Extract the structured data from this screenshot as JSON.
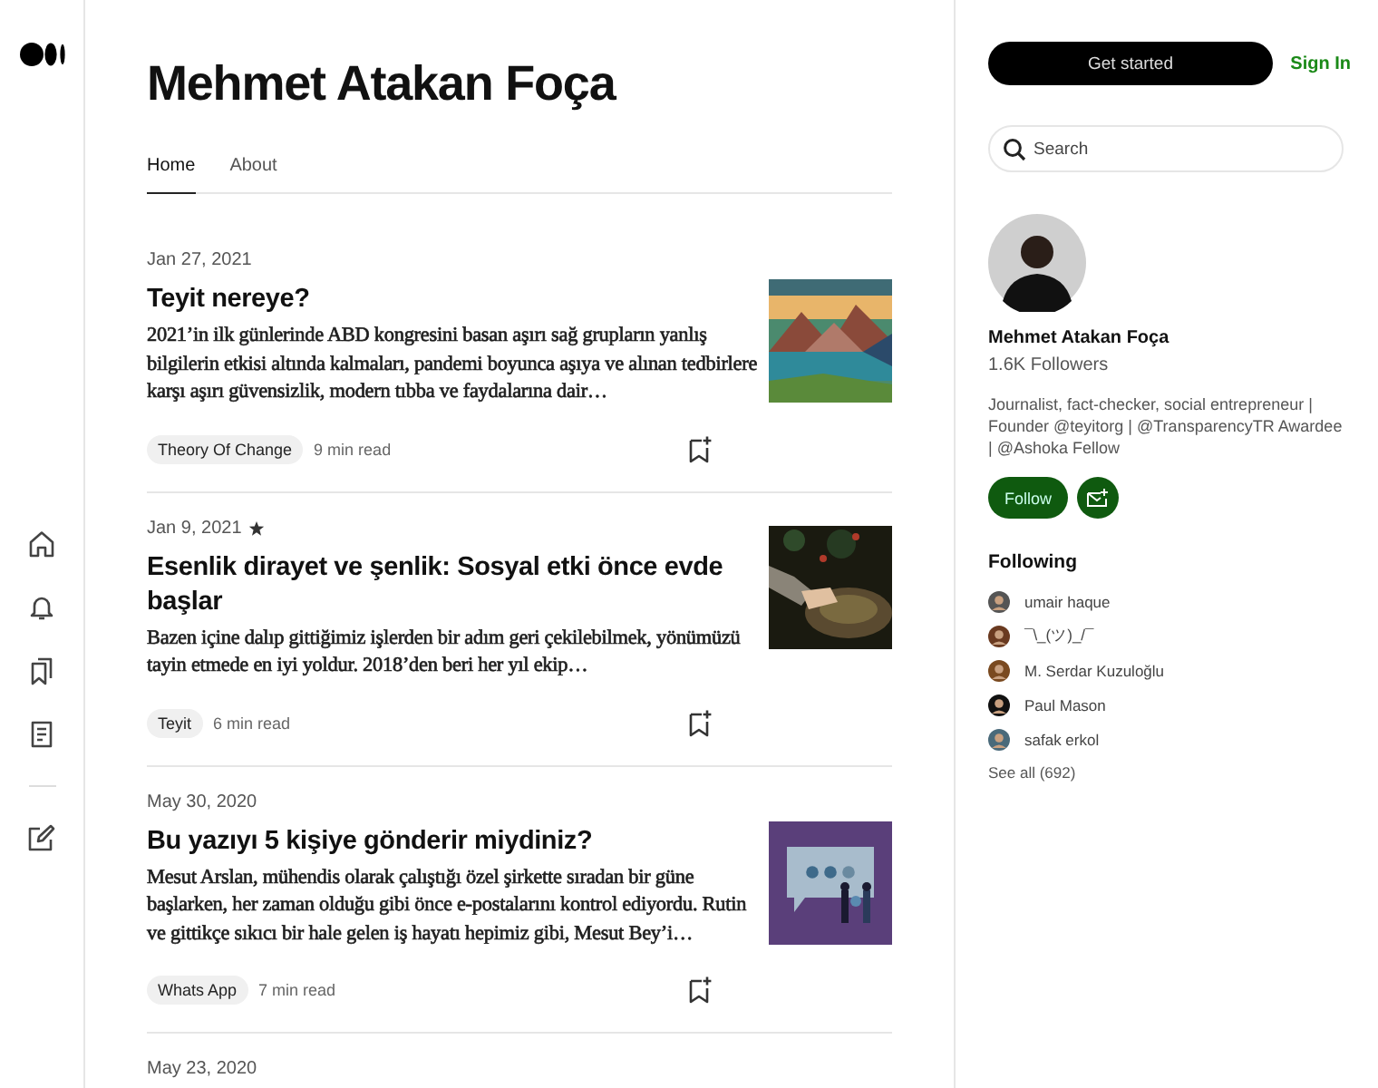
{
  "page_title": "Mehmet Atakan Foça",
  "profile": {
    "name": "Mehmet Atakan Foça",
    "followers": "1.6K Followers",
    "bio": "Journalist, fact-checker, social entrepreneur | Founder @teyitorg | @TransparencyTR Awardee | @Ashoka Fellow",
    "follow_button": "Follow"
  },
  "tabs": [
    {
      "label": "Home",
      "selected": true
    },
    {
      "label": "About",
      "selected": false
    }
  ],
  "articles": [
    {
      "date": "Jan 27, 2021",
      "starred": false,
      "title": "Teyit nereye?",
      "excerpt": "2021’in ilk günlerinde ABD kongresini basan aşırı sağ grupların yanlış bilgilerin etkisi altında kalmaları, pandemi boyunca aşıya ve alınan tedbirlere karşı aşırı güvensizlik, modern tıbba ve faydalarına dair…",
      "tag": "Theory Of Change",
      "read_time": "9 min read"
    },
    {
      "date": "Jan 9, 2021",
      "starred": true,
      "title": "Esenlik dirayet ve şenlik: Sosyal etki önce evde başlar",
      "excerpt": "Bazen içine dalıp gittiğimiz işlerden bir adım geri çekilebilmek, yönümüzü tayin etmede en iyi yoldur. 2018’den beri her yıl ekip…",
      "tag": "Teyit",
      "read_time": "6 min read"
    },
    {
      "date": "May 30, 2020",
      "starred": false,
      "title": "Bu yazıyı 5 kişiye gönderir miydiniz?",
      "excerpt": "Mesut Arslan, mühendis olarak çalıştığı özel şirkette sıradan bir güne başlarken, her zaman olduğu gibi önce e-postalarını kontrol ediyordu. Rutin ve gittikçe sıkıcı bir hale gelen iş hayatı hepimiz gibi, Mesut Bey’i…",
      "tag": "Whats App",
      "read_time": "7 min read"
    },
    {
      "date": "May 23, 2020",
      "starred": false
    }
  ],
  "header": {
    "get_started": "Get started",
    "sign_in": "Sign In"
  },
  "search": {
    "placeholder": "Search"
  },
  "following": {
    "title": "Following",
    "people": [
      {
        "name": "umair haque"
      },
      {
        "name": "¯\\_(ツ)_/¯"
      },
      {
        "name": "M. Serdar Kuzuloğlu"
      },
      {
        "name": "Paul Mason"
      },
      {
        "name": "safak erkol"
      }
    ],
    "see_all": "See all (692)"
  }
}
